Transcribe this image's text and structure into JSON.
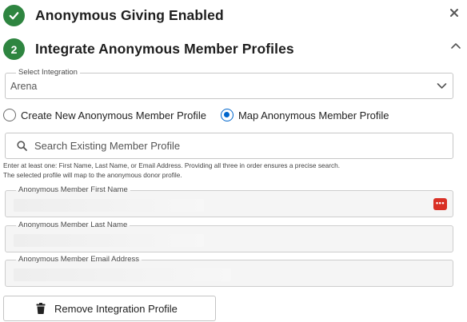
{
  "step1": {
    "title": "Anonymous Giving Enabled",
    "status": "complete"
  },
  "step2": {
    "number": "2",
    "title": "Integrate Anonymous Member Profiles",
    "expanded": true
  },
  "integration_select": {
    "legend": "Select Integration",
    "value": "Arena"
  },
  "profile_mode": {
    "options": [
      {
        "label": "Create New Anonymous Member Profile",
        "selected": false
      },
      {
        "label": "Map Anonymous Member Profile",
        "selected": true
      }
    ]
  },
  "search": {
    "placeholder": "Search Existing Member Profile"
  },
  "help": {
    "line1": "Enter at least one: First Name, Last Name, or Email Address. Providing all three in order ensures a precise search.",
    "line2": "The selected profile will map to the anonymous donor profile."
  },
  "member_fields": {
    "first_name": {
      "legend": "Anonymous Member First Name"
    },
    "last_name": {
      "legend": "Anonymous Member Last Name"
    },
    "email": {
      "legend": "Anonymous Member Email Address"
    }
  },
  "remove_button": {
    "label": "Remove Integration Profile"
  },
  "colors": {
    "success": "#2e8540",
    "accent": "#0066cc",
    "password_manager": "#d93025"
  },
  "icons": [
    "check-icon",
    "close-icon",
    "chevron-up-icon",
    "chevron-down-icon",
    "search-icon",
    "password-manager-icon",
    "trash-icon"
  ]
}
